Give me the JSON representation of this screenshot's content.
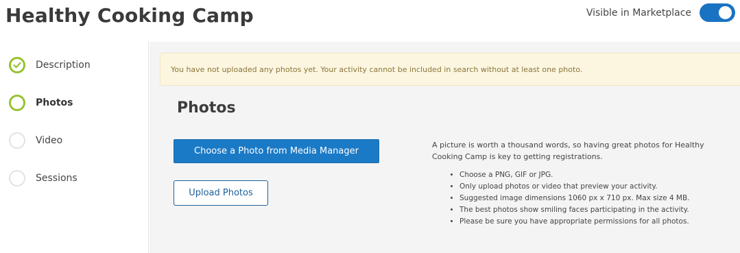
{
  "page": {
    "title": "Healthy Cooking Camp",
    "visible_label": "Visible in Marketplace",
    "visible_on": true
  },
  "sidebar": {
    "steps": [
      {
        "label": "Description",
        "state": "done"
      },
      {
        "label": "Photos",
        "state": "active"
      },
      {
        "label": "Video",
        "state": "pending"
      },
      {
        "label": "Sessions",
        "state": "pending"
      }
    ]
  },
  "main": {
    "alert": "You have not uploaded any photos yet. Your activity cannot be included in search without at least one photo.",
    "section_title": "Photos",
    "choose_button": "Choose a Photo from Media Manager",
    "upload_button": "Upload Photos",
    "info_text": "A picture is worth a thousand words, so having great photos for Healthy Cooking Camp is key to getting registrations.",
    "tips": [
      "Choose a PNG, GIF or JPG.",
      "Only upload photos or video that preview your activity.",
      "Suggested image dimensions 1060 px x 710 px. Max size 4 MB.",
      "The best photos show smiling faces participating in the activity.",
      "Please be sure you have appropriate permissions for all photos."
    ]
  },
  "colors": {
    "accent": "#1b7ac6",
    "step_done": "#97c231",
    "alert_bg": "#fcf6e1",
    "alert_text": "#8b7538"
  }
}
